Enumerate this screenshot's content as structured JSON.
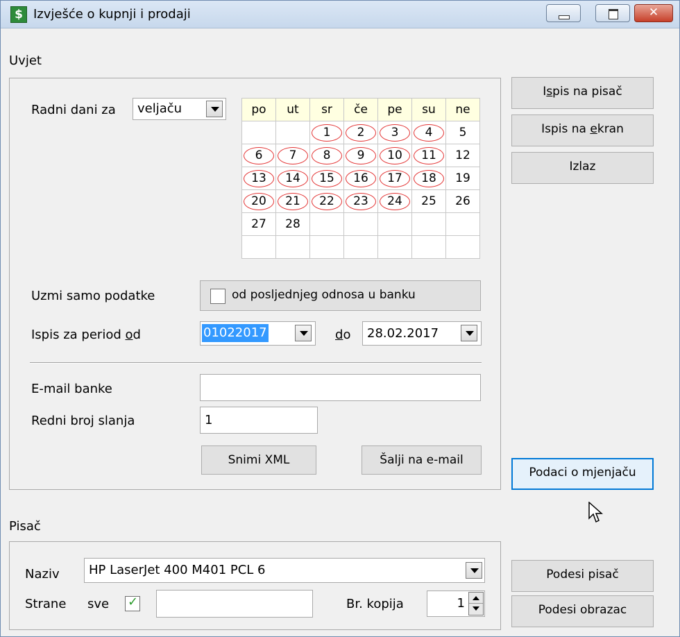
{
  "window": {
    "title": "Izvješće o kupnji i prodaji",
    "icon": "dollar-app-icon",
    "icon_glyph": "$"
  },
  "condition_group": {
    "label": "Uvjet",
    "working_days_label": "Radni dani za",
    "month_value": "veljaču",
    "calendar": {
      "headers": [
        "po",
        "ut",
        "sr",
        "če",
        "pe",
        "su",
        "ne"
      ],
      "rows": [
        [
          "",
          "",
          "1",
          "2",
          "3",
          "4",
          "5"
        ],
        [
          "6",
          "7",
          "8",
          "9",
          "10",
          "11",
          "12"
        ],
        [
          "13",
          "14",
          "15",
          "16",
          "17",
          "18",
          "19"
        ],
        [
          "20",
          "21",
          "22",
          "23",
          "24",
          "25",
          "26"
        ],
        [
          "27",
          "28",
          "",
          "",
          "",
          "",
          ""
        ],
        [
          "",
          "",
          "",
          "",
          "",
          "",
          ""
        ]
      ],
      "circled_days": [
        "1",
        "2",
        "3",
        "4",
        "6",
        "7",
        "8",
        "9",
        "10",
        "11",
        "13",
        "14",
        "15",
        "16",
        "17",
        "18",
        "20",
        "21",
        "22",
        "23",
        "24"
      ],
      "circle_color": "#e33333"
    },
    "take_only_label": "Uzmi samo podatke",
    "last_bank_checkbox_label": "od posljednjeg odnosa u banku",
    "last_bank_checked": false,
    "period_from_label": "Ispis za period od",
    "period_from_value": "01022017",
    "period_to_label": "do",
    "period_to_value": "28.02.2017",
    "bank_email_label": "E-mail banke",
    "bank_email_value": "",
    "send_number_label": "Redni broj slanja",
    "send_number_value": "1",
    "save_xml_label": "Snimi XML",
    "send_email_label": "Šalji na e-mail"
  },
  "side_buttons": {
    "print_printer": "Ispis na pisač",
    "print_screen": "Ispis na ekran",
    "exit": "Izlaz",
    "exchange_data": "Podaci o mjenjaču"
  },
  "printer_group": {
    "label": "Pisač",
    "name_label": "Naziv",
    "printer_name": "HP LaserJet 400 M401 PCL 6",
    "pages_label": "Strane",
    "all_label": "sve",
    "all_checked": true,
    "pages_value": "",
    "copies_label": "Br. kopija",
    "copies_value": "1",
    "setup_printer": "Podesi pisač",
    "setup_form": "Podesi obrazac"
  },
  "colors": {
    "selection": "#3399ff",
    "focus_border": "#0078d7",
    "check_green": "#2b9b2b"
  }
}
